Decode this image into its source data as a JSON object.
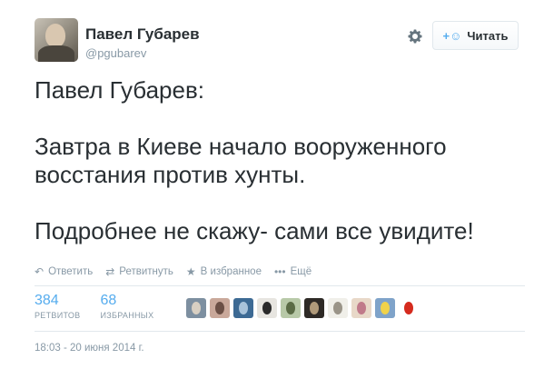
{
  "author": {
    "name": "Павел Губарев",
    "handle": "@pgubarev"
  },
  "follow_button": {
    "label": "Читать",
    "icon": "add-user-icon"
  },
  "settings_icon": "gear-icon",
  "tweet": {
    "paragraphs": [
      "Павел Губарев:",
      "Завтра в Киеве начало вооруженного восстания против хунты.",
      "Подробнее не скажу- сами все увидите!"
    ]
  },
  "actions": {
    "reply": "Ответить",
    "retweet": "Ретвитнуть",
    "favorite": "В избранное",
    "more": "Ещё"
  },
  "stats": {
    "retweets": {
      "count": "384",
      "label": "РЕТВИТОВ"
    },
    "favorites": {
      "count": "68",
      "label": "ИЗБРАННЫХ"
    }
  },
  "timestamp": "18:03 - 20 июня 2014 г.",
  "colors": {
    "accent": "#55acee",
    "text": "#292f33",
    "muted": "#8899a6",
    "border": "#e1e8ed"
  },
  "favoriter_avatars": [
    {
      "bg": "#7d8fa0",
      "fg": "#d8cfc2"
    },
    {
      "bg": "#c9a89a",
      "fg": "#6b4f45"
    },
    {
      "bg": "#3d6a94",
      "fg": "#a9c3da"
    },
    {
      "bg": "#e7e5e0",
      "fg": "#2a2a2a"
    },
    {
      "bg": "#b8c9a8",
      "fg": "#5a6b45"
    },
    {
      "bg": "#2e2a26",
      "fg": "#b09a7a"
    },
    {
      "bg": "#f0efe9",
      "fg": "#9a9488"
    },
    {
      "bg": "#e8d8c8",
      "fg": "#c07a8a"
    },
    {
      "bg": "#7fa3c9",
      "fg": "#f0d24a"
    },
    {
      "bg": "#ffffff",
      "fg": "#d52b1e"
    }
  ]
}
